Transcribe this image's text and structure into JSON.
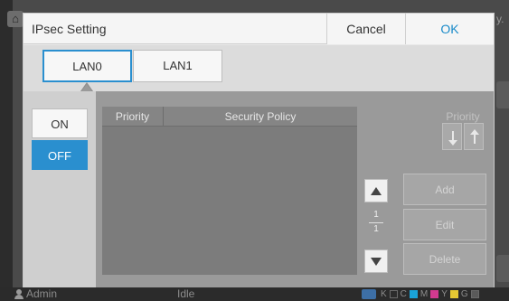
{
  "dialog": {
    "title": "IPsec Setting",
    "cancel_label": "Cancel",
    "ok_label": "OK"
  },
  "tabs": [
    {
      "label": "LAN0",
      "selected": true
    },
    {
      "label": "LAN1",
      "selected": false
    }
  ],
  "toggle": {
    "on_label": "ON",
    "off_label": "OFF",
    "selected": "OFF"
  },
  "table": {
    "columns": [
      "Priority",
      "Security Policy"
    ],
    "rows": []
  },
  "pager": {
    "current": "1",
    "total": "1"
  },
  "priority": {
    "label": "Priority"
  },
  "actions": {
    "add_label": "Add",
    "edit_label": "Edit",
    "delete_label": "Delete"
  },
  "background": {
    "right_edge_text": "y."
  },
  "status_bar": {
    "user": "Admin",
    "state": "Idle",
    "ink": [
      "K",
      "C",
      "M",
      "Y",
      "G"
    ]
  },
  "colors": {
    "accent": "#2a8fcf",
    "ok_text": "#1a8bc9",
    "ink_k": "#2b2b2b",
    "ink_c": "#1aa3d9",
    "ink_m": "#d23a8f",
    "ink_y": "#e5c833",
    "ink_g": "#5a5a5a"
  }
}
